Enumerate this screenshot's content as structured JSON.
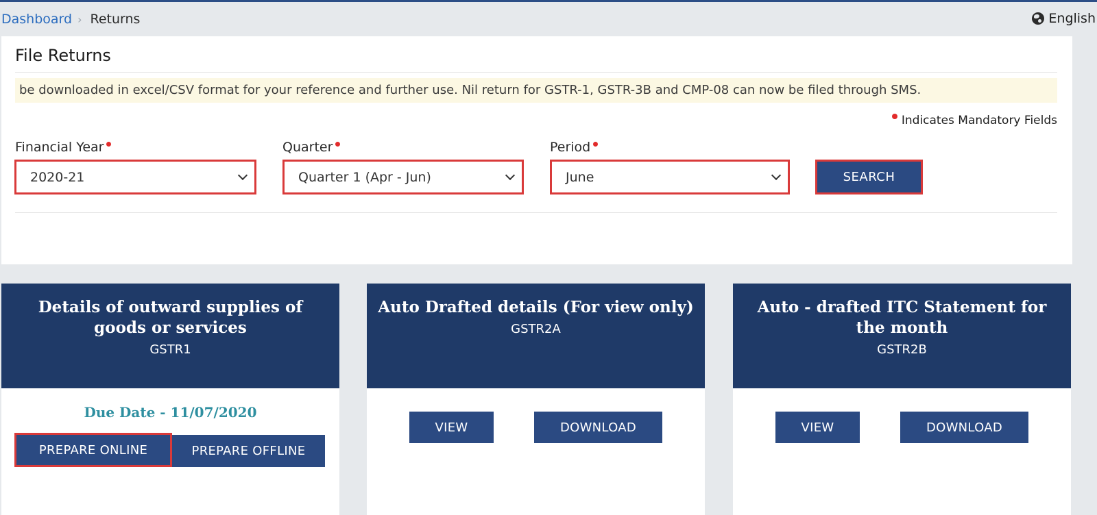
{
  "breadcrumb": {
    "home": "Dashboard",
    "separator": "›",
    "current": "Returns"
  },
  "language": {
    "label": "English",
    "icon": "globe-icon"
  },
  "page": {
    "title": "File Returns",
    "notice": "be downloaded in excel/CSV format for your reference and further use. Nil return for GSTR-1, GSTR-3B and CMP-08 can now be filed through SMS.",
    "mandatory_note": "Indicates Mandatory Fields"
  },
  "form": {
    "financial_year": {
      "label": "Financial Year",
      "value": "2020-21"
    },
    "quarter": {
      "label": "Quarter",
      "value": "Quarter 1 (Apr - Jun)"
    },
    "period": {
      "label": "Period",
      "value": "June"
    },
    "search_label": "SEARCH"
  },
  "cards": [
    {
      "title": "Details of outward supplies of goods or services",
      "code": "GSTR1",
      "due_date": "Due Date -  11/07/2020",
      "buttons": [
        "PREPARE ONLINE",
        "PREPARE OFFLINE"
      ]
    },
    {
      "title": "Auto Drafted details (For view only)",
      "code": "GSTR2A",
      "buttons": [
        "VIEW",
        "DOWNLOAD"
      ]
    },
    {
      "title": "Auto - drafted ITC Statement for the month",
      "code": "GSTR2B",
      "buttons": [
        "VIEW",
        "DOWNLOAD"
      ]
    }
  ],
  "colors": {
    "header_navy": "#1f3a68",
    "button_blue": "#2b4a82",
    "highlight_red": "#d93a3a",
    "due_date_teal": "#2e8fa0",
    "link_blue": "#2c6dbf"
  }
}
